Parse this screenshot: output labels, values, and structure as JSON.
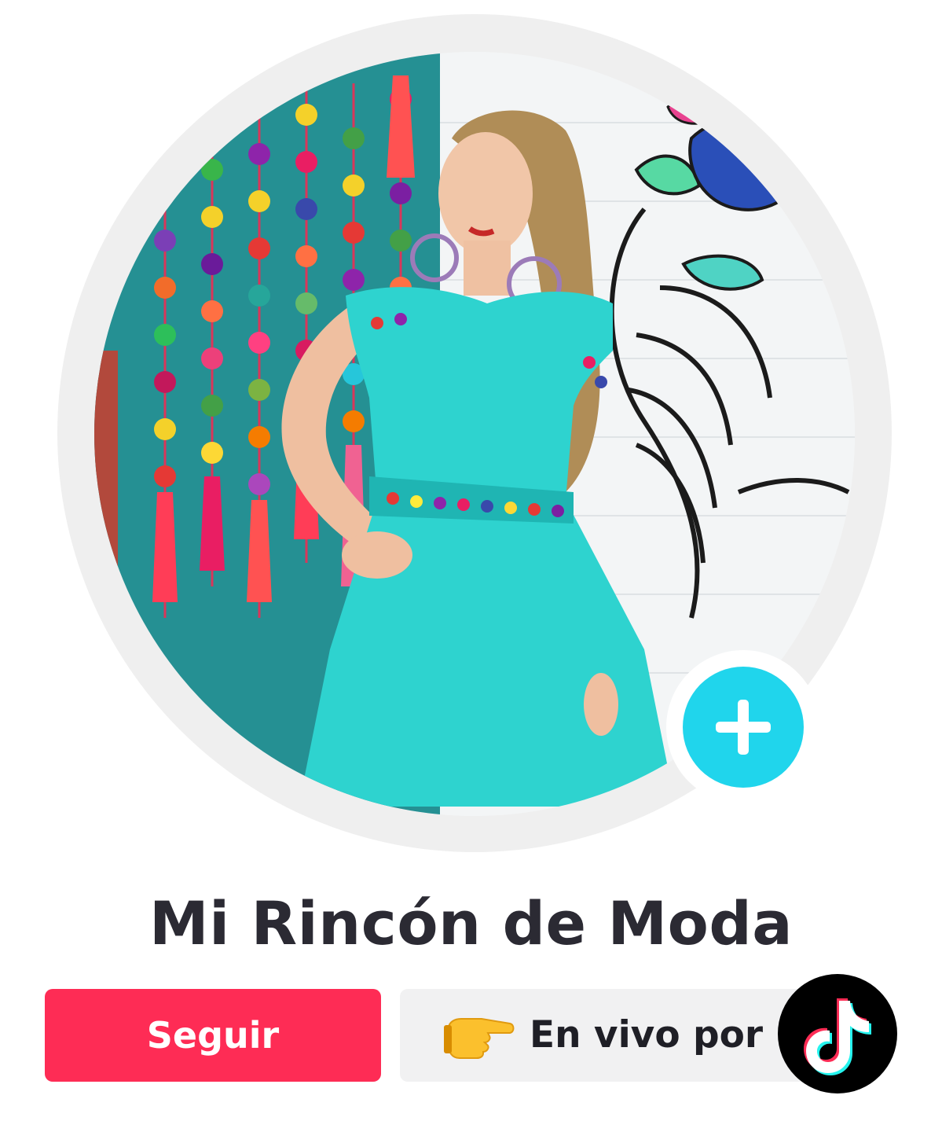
{
  "profile": {
    "name": "Mi Rincón de Moda"
  },
  "actions": {
    "follow_label": "Seguir",
    "live_label": "En vivo por"
  },
  "icons": {
    "follow_plus": "plus-icon",
    "pointing_hand": "pointing-right-hand-emoji",
    "platform_logo": "tiktok-logo"
  },
  "colors": {
    "follow_button": "#fe2c55",
    "plus_badge": "#20d5ec",
    "name_text": "#2b2a33",
    "live_box": "#f1f1f2"
  }
}
